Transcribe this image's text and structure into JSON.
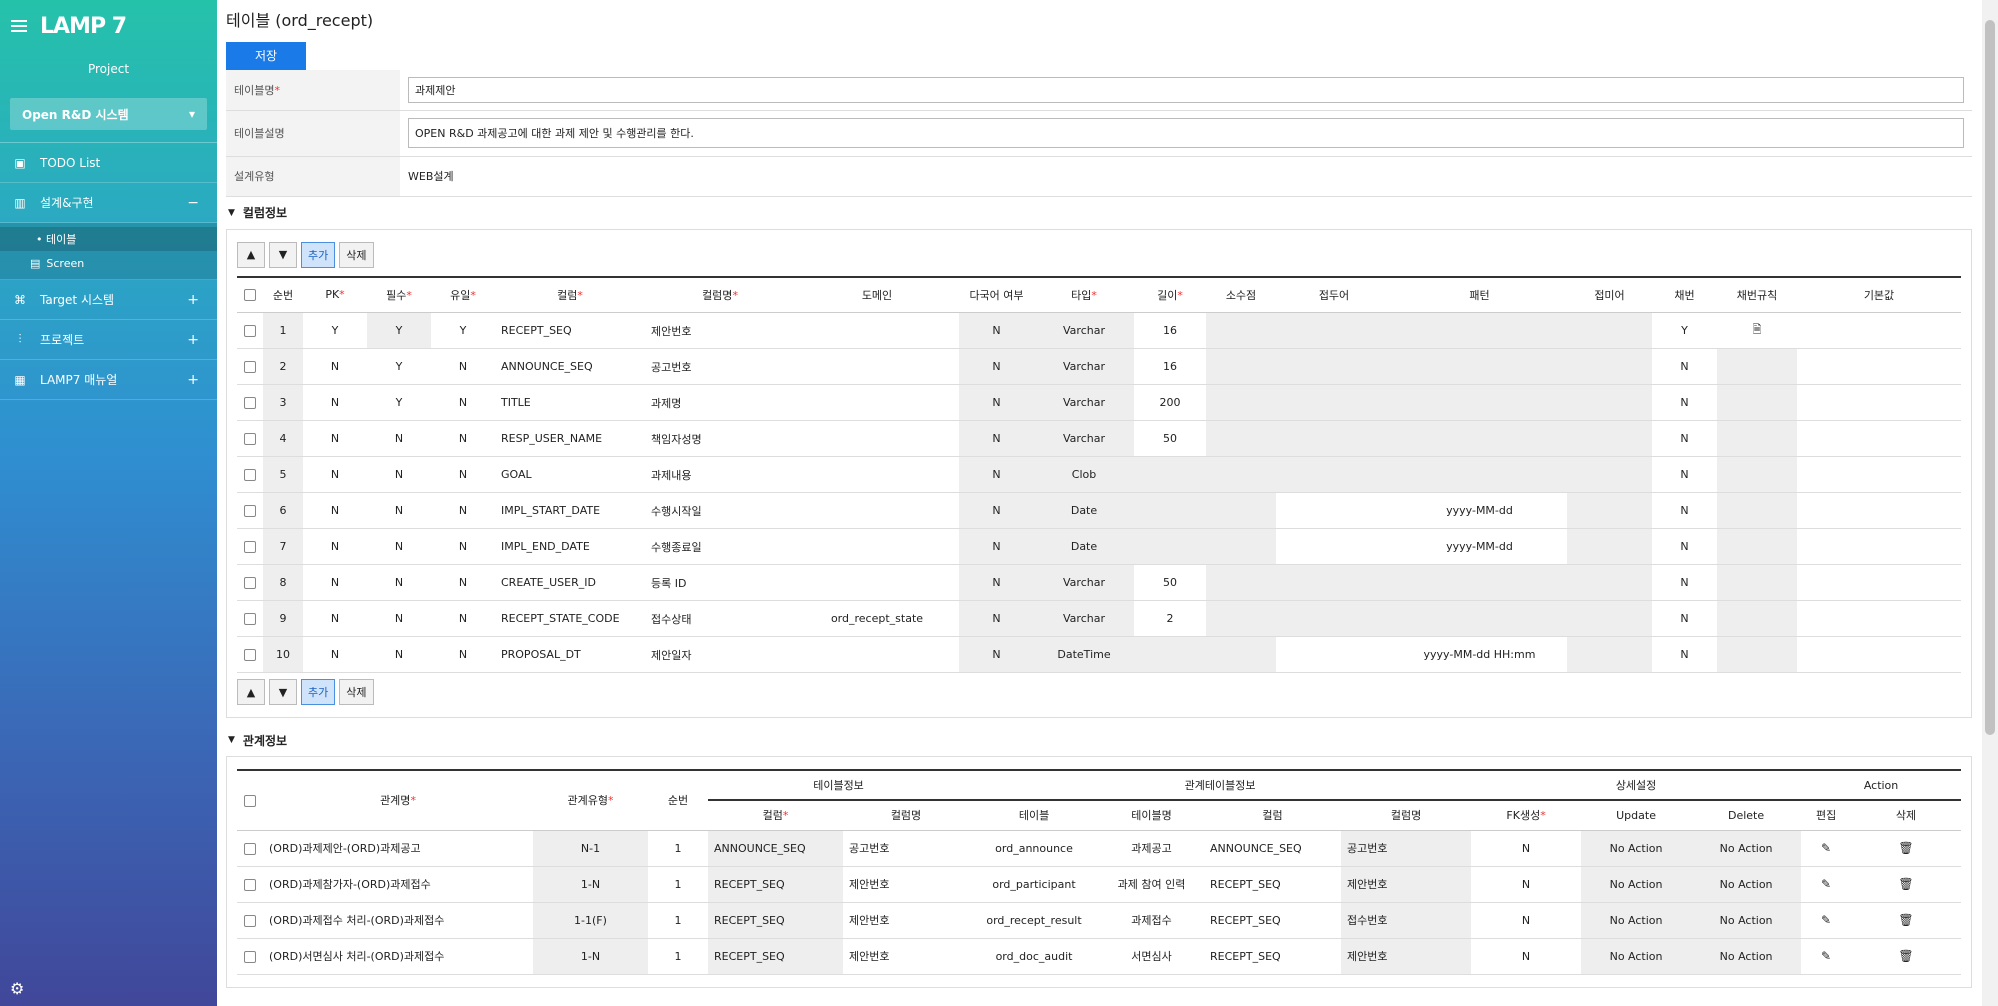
{
  "sidebar": {
    "logo": "LAMP 7",
    "project_label": "Project",
    "project_select": "Open R&D 시스템",
    "menu": [
      {
        "label": "TODO List",
        "toggle": ""
      },
      {
        "label": "설계&구현",
        "toggle": "−"
      },
      {
        "label": "Target 시스템",
        "toggle": "+"
      },
      {
        "label": "프로젝트",
        "toggle": "+"
      },
      {
        "label": "LAMP7 매뉴얼",
        "toggle": "+"
      }
    ],
    "sub": [
      "• 테이블",
      "Screen"
    ]
  },
  "page": {
    "title": "테이블 (ord_recept)",
    "save": "저장"
  },
  "form": {
    "name_label": "테이블명",
    "name_value": "과제제안",
    "desc_label": "테이블설명",
    "desc_value": "OPEN R&D 과제공고에 대한 과제 제안 및 수행관리를 한다.",
    "type_label": "설계유형",
    "type_value": "WEB설계"
  },
  "columns_section": {
    "title": "컬럼정보",
    "add": "추가",
    "del": "삭제",
    "headers": [
      "순번",
      "PK",
      "필수",
      "유일",
      "컬럼",
      "컬럼명",
      "도메인",
      "다국어 여부",
      "타입",
      "길이",
      "소수점",
      "접두어",
      "패턴",
      "접미어",
      "채번",
      "채번규칙",
      "기본값"
    ],
    "rows": [
      [
        "1",
        "Y",
        "Y",
        "Y",
        "RECEPT_SEQ",
        "제안번호",
        "",
        "N",
        "Varchar",
        "16",
        "",
        "",
        "",
        "",
        "Y",
        "",
        "",
        ""
      ],
      [
        "2",
        "N",
        "Y",
        "N",
        "ANNOUNCE_SEQ",
        "공고번호",
        "",
        "N",
        "Varchar",
        "16",
        "",
        "",
        "",
        "",
        "N",
        "",
        ""
      ],
      [
        "3",
        "N",
        "Y",
        "N",
        "TITLE",
        "과제명",
        "",
        "N",
        "Varchar",
        "200",
        "",
        "",
        "",
        "",
        "N",
        "",
        ""
      ],
      [
        "4",
        "N",
        "N",
        "N",
        "RESP_USER_NAME",
        "책임자성명",
        "",
        "N",
        "Varchar",
        "50",
        "",
        "",
        "",
        "",
        "N",
        "",
        ""
      ],
      [
        "5",
        "N",
        "N",
        "N",
        "GOAL",
        "과제내용",
        "",
        "N",
        "Clob",
        "",
        "",
        "",
        "",
        "",
        "N",
        "",
        ""
      ],
      [
        "6",
        "N",
        "N",
        "N",
        "IMPL_START_DATE",
        "수행시작일",
        "",
        "N",
        "Date",
        "",
        "",
        "",
        "yyyy-MM-dd",
        "",
        "N",
        "",
        ""
      ],
      [
        "7",
        "N",
        "N",
        "N",
        "IMPL_END_DATE",
        "수행종료일",
        "",
        "N",
        "Date",
        "",
        "",
        "",
        "yyyy-MM-dd",
        "",
        "N",
        "",
        ""
      ],
      [
        "8",
        "N",
        "N",
        "N",
        "CREATE_USER_ID",
        "등록 ID",
        "",
        "N",
        "Varchar",
        "50",
        "",
        "",
        "",
        "",
        "N",
        "",
        ""
      ],
      [
        "9",
        "N",
        "N",
        "N",
        "RECEPT_STATE_CODE",
        "접수상태",
        "ord_recept_state",
        "N",
        "Varchar",
        "2",
        "",
        "",
        "",
        "",
        "N",
        "",
        ""
      ],
      [
        "10",
        "N",
        "N",
        "N",
        "PROPOSAL_DT",
        "제안일자",
        "",
        "N",
        "DateTime",
        "",
        "",
        "",
        "yyyy-MM-dd HH:mm",
        "",
        "N",
        "",
        ""
      ]
    ]
  },
  "relations_section": {
    "title": "관계정보",
    "h_name": "관계명",
    "h_type": "관계유형",
    "h_seq": "순번",
    "h_table_info": "테이블정보",
    "h_rel_info": "관계테이블정보",
    "h_detail": "상세설정",
    "h_action": "Action",
    "sub_headers": [
      "컬럼",
      "컬럼명",
      "테이블",
      "테이블명",
      "컬럼",
      "컬럼명",
      "FK생성",
      "Update",
      "Delete",
      "편집",
      "삭제"
    ],
    "rows": [
      [
        "(ORD)과제제안-(ORD)과제공고",
        "N-1",
        "1",
        "ANNOUNCE_SEQ",
        "공고번호",
        "ord_announce",
        "과제공고",
        "ANNOUNCE_SEQ",
        "공고번호",
        "N",
        "No Action",
        "No Action"
      ],
      [
        "(ORD)과제참가자-(ORD)과제접수",
        "1-N",
        "1",
        "RECEPT_SEQ",
        "제안번호",
        "ord_participant",
        "과제 참여 인력",
        "RECEPT_SEQ",
        "제안번호",
        "N",
        "No Action",
        "No Action"
      ],
      [
        "(ORD)과제접수 처리-(ORD)과제접수",
        "1-1(F)",
        "1",
        "RECEPT_SEQ",
        "제안번호",
        "ord_recept_result",
        "과제접수",
        "RECEPT_SEQ",
        "접수번호",
        "N",
        "No Action",
        "No Action"
      ],
      [
        "(ORD)서면심사 처리-(ORD)과제접수",
        "1-N",
        "1",
        "RECEPT_SEQ",
        "제안번호",
        "ord_doc_audit",
        "서면심사",
        "RECEPT_SEQ",
        "제안번호",
        "N",
        "No Action",
        "No Action"
      ]
    ]
  }
}
